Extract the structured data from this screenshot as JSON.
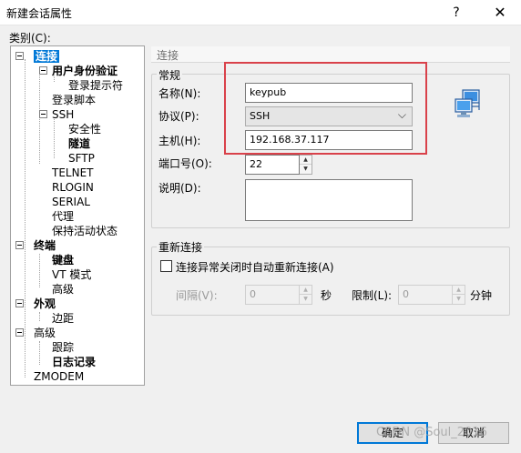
{
  "window": {
    "title": "新建会话属性",
    "help_glyph": "?",
    "close_glyph": "✕"
  },
  "category_label": "类别(C):",
  "tree": [
    {
      "label": "连接",
      "bold": true,
      "selected": true
    },
    {
      "label": "用户身份验证",
      "bold": true
    },
    {
      "label": "登录提示符"
    },
    {
      "label": "登录脚本"
    },
    {
      "label": "SSH"
    },
    {
      "label": "安全性"
    },
    {
      "label": "隧道",
      "bold": true
    },
    {
      "label": "SFTP"
    },
    {
      "label": "TELNET"
    },
    {
      "label": "RLOGIN"
    },
    {
      "label": "SERIAL"
    },
    {
      "label": "代理"
    },
    {
      "label": "保持活动状态"
    },
    {
      "label": "终端",
      "bold": true
    },
    {
      "label": "键盘",
      "bold": true
    },
    {
      "label": "VT 模式"
    },
    {
      "label": "高级"
    },
    {
      "label": "外观",
      "bold": true
    },
    {
      "label": "边距"
    },
    {
      "label": "高级"
    },
    {
      "label": "跟踪"
    },
    {
      "label": "日志记录",
      "bold": true
    },
    {
      "label": "ZMODEM"
    }
  ],
  "content": {
    "header": "连接",
    "general": {
      "title": "常规",
      "name_label": "名称(N):",
      "name_value": "keypub",
      "protocol_label": "协议(P):",
      "protocol_value": "SSH",
      "host_label": "主机(H):",
      "host_value": "192.168.37.117",
      "port_label": "端口号(O):",
      "port_value": "22",
      "desc_label": "说明(D):",
      "desc_value": ""
    },
    "reconnect": {
      "title": "重新连接",
      "checkbox_label": "连接异常关闭时自动重新连接(A)",
      "interval_label": "间隔(V):",
      "interval_value": "0",
      "seconds_unit": "秒",
      "limit_label": "限制(L):",
      "limit_value": "0",
      "minutes_unit": "分钟"
    }
  },
  "buttons": {
    "ok": "确定",
    "cancel": "取消"
  },
  "watermark": "CSDN @Soul_2016"
}
